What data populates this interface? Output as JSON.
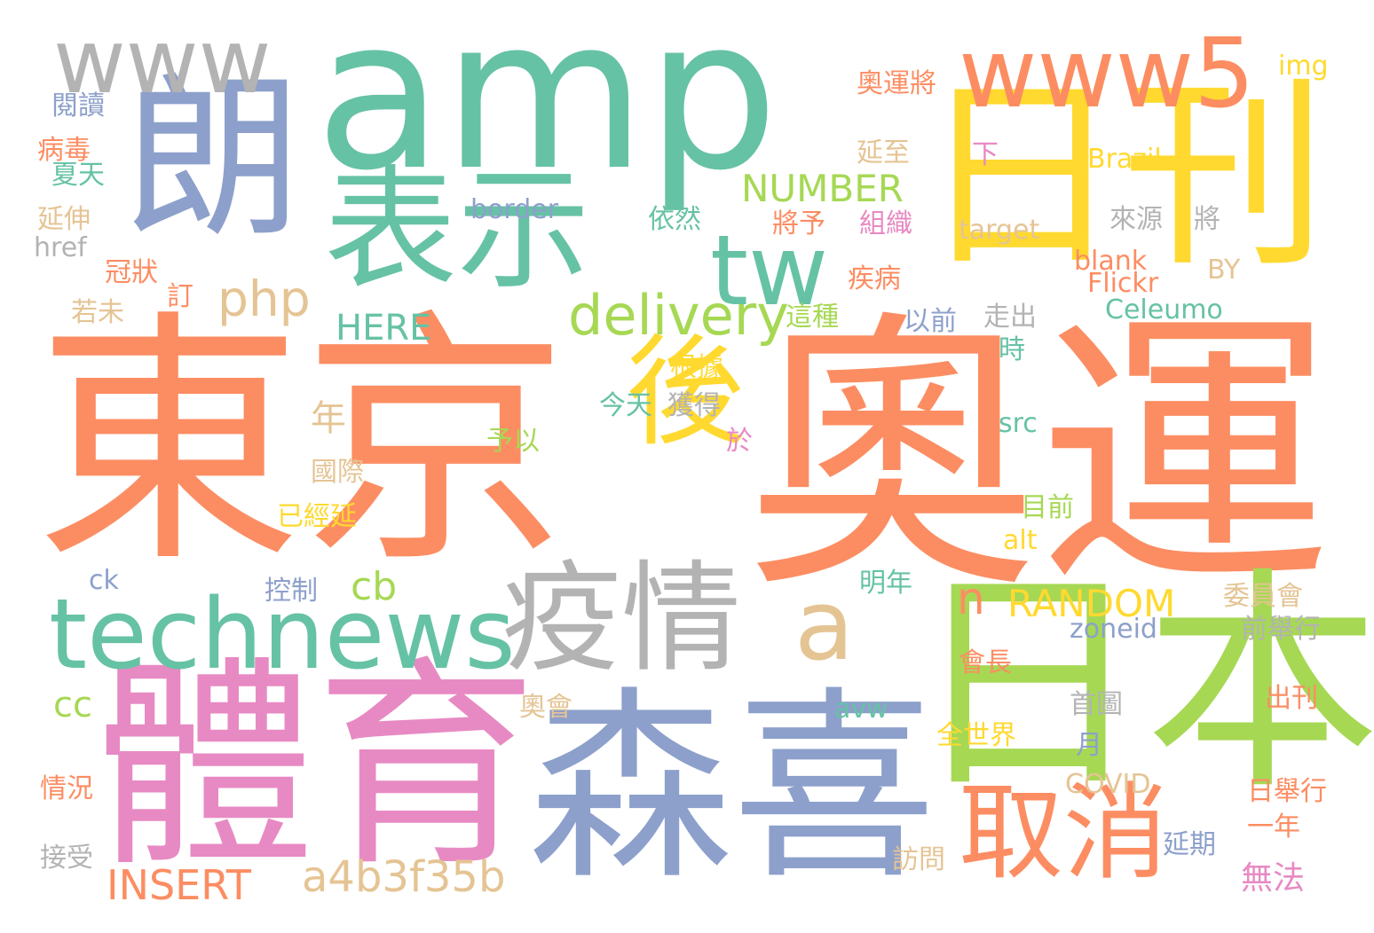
{
  "palette": {
    "orange": "#fc8d62",
    "teal": "#66c2a5",
    "blue": "#8da0cb",
    "pink": "#e78ac3",
    "green": "#a6d854",
    "yellow": "#ffd92f",
    "tan": "#e5c494",
    "gray": "#b3b3b3"
  },
  "words": [
    {
      "text": "東京",
      "color": "orange"
    },
    {
      "text": "奧運",
      "color": "orange"
    },
    {
      "text": "amp",
      "color": "teal"
    },
    {
      "text": "日刊",
      "color": "yellow"
    },
    {
      "text": "體育",
      "color": "pink"
    },
    {
      "text": "森喜",
      "color": "blue"
    },
    {
      "text": "日本",
      "color": "green"
    },
    {
      "text": "朗",
      "color": "blue"
    },
    {
      "text": "表示",
      "color": "teal"
    },
    {
      "text": "疫情",
      "color": "gray"
    },
    {
      "text": "technews",
      "color": "teal"
    },
    {
      "text": "www",
      "color": "gray"
    },
    {
      "text": "www5",
      "color": "orange"
    },
    {
      "text": "取消",
      "color": "orange"
    },
    {
      "text": "後",
      "color": "yellow"
    },
    {
      "text": "tw",
      "color": "teal"
    },
    {
      "text": "a",
      "color": "tan"
    },
    {
      "text": "delivery",
      "color": "green"
    },
    {
      "text": "php",
      "color": "tan"
    },
    {
      "text": "a4b3f35b",
      "color": "tan"
    },
    {
      "text": "INSERT",
      "color": "orange"
    },
    {
      "text": "NUMBER",
      "color": "green"
    },
    {
      "text": "RANDOM",
      "color": "yellow"
    },
    {
      "text": "HERE",
      "color": "teal"
    },
    {
      "text": "n",
      "color": "orange"
    },
    {
      "text": "cb",
      "color": "green"
    },
    {
      "text": "cc",
      "color": "green"
    },
    {
      "text": "border",
      "color": "blue"
    },
    {
      "text": "target",
      "color": "tan"
    },
    {
      "text": "blank",
      "color": "orange"
    },
    {
      "text": "Flickr",
      "color": "orange"
    },
    {
      "text": "Celeumo",
      "color": "teal"
    },
    {
      "text": "Brazil",
      "color": "yellow"
    },
    {
      "text": "img",
      "color": "yellow"
    },
    {
      "text": "BY",
      "color": "tan"
    },
    {
      "text": "href",
      "color": "gray"
    },
    {
      "text": "ck",
      "color": "blue"
    },
    {
      "text": "src",
      "color": "teal"
    },
    {
      "text": "alt",
      "color": "yellow"
    },
    {
      "text": "zoneid",
      "color": "blue"
    },
    {
      "text": "avw",
      "color": "teal"
    },
    {
      "text": "COVID",
      "color": "tan"
    },
    {
      "text": "閱讀",
      "color": "blue"
    },
    {
      "text": "病毒",
      "color": "orange"
    },
    {
      "text": "夏天",
      "color": "teal"
    },
    {
      "text": "延伸",
      "color": "tan"
    },
    {
      "text": "冠狀",
      "color": "orange"
    },
    {
      "text": "訂",
      "color": "orange"
    },
    {
      "text": "若未",
      "color": "tan"
    },
    {
      "text": "奧運將",
      "color": "orange"
    },
    {
      "text": "延至",
      "color": "tan"
    },
    {
      "text": "下",
      "color": "pink"
    },
    {
      "text": "依然",
      "color": "teal"
    },
    {
      "text": "將予",
      "color": "orange"
    },
    {
      "text": "組織",
      "color": "pink"
    },
    {
      "text": "來源",
      "color": "gray"
    },
    {
      "text": "將",
      "color": "gray"
    },
    {
      "text": "疾病",
      "color": "orange"
    },
    {
      "text": "這種",
      "color": "green"
    },
    {
      "text": "以前",
      "color": "blue"
    },
    {
      "text": "走出",
      "color": "gray"
    },
    {
      "text": "時",
      "color": "teal"
    },
    {
      "text": "根據",
      "color": "yellow"
    },
    {
      "text": "今天",
      "color": "teal"
    },
    {
      "text": "獲得",
      "color": "gray"
    },
    {
      "text": "年",
      "color": "tan"
    },
    {
      "text": "予以",
      "color": "green"
    },
    {
      "text": "於",
      "color": "pink"
    },
    {
      "text": "國際",
      "color": "tan"
    },
    {
      "text": "已經延",
      "color": "yellow"
    },
    {
      "text": "目前",
      "color": "green"
    },
    {
      "text": "控制",
      "color": "blue"
    },
    {
      "text": "明年",
      "color": "teal"
    },
    {
      "text": "委員會",
      "color": "tan"
    },
    {
      "text": "前舉行",
      "color": "gray"
    },
    {
      "text": "會長",
      "color": "orange"
    },
    {
      "text": "奧會",
      "color": "tan"
    },
    {
      "text": "首圖",
      "color": "gray"
    },
    {
      "text": "出刊",
      "color": "orange"
    },
    {
      "text": "全世界",
      "color": "yellow"
    },
    {
      "text": "月",
      "color": "blue"
    },
    {
      "text": "情況",
      "color": "orange"
    },
    {
      "text": "日舉行",
      "color": "orange"
    },
    {
      "text": "一年",
      "color": "orange"
    },
    {
      "text": "接受",
      "color": "gray"
    },
    {
      "text": "延期",
      "color": "blue"
    },
    {
      "text": "訪問",
      "color": "tan"
    },
    {
      "text": "無法",
      "color": "pink"
    }
  ]
}
